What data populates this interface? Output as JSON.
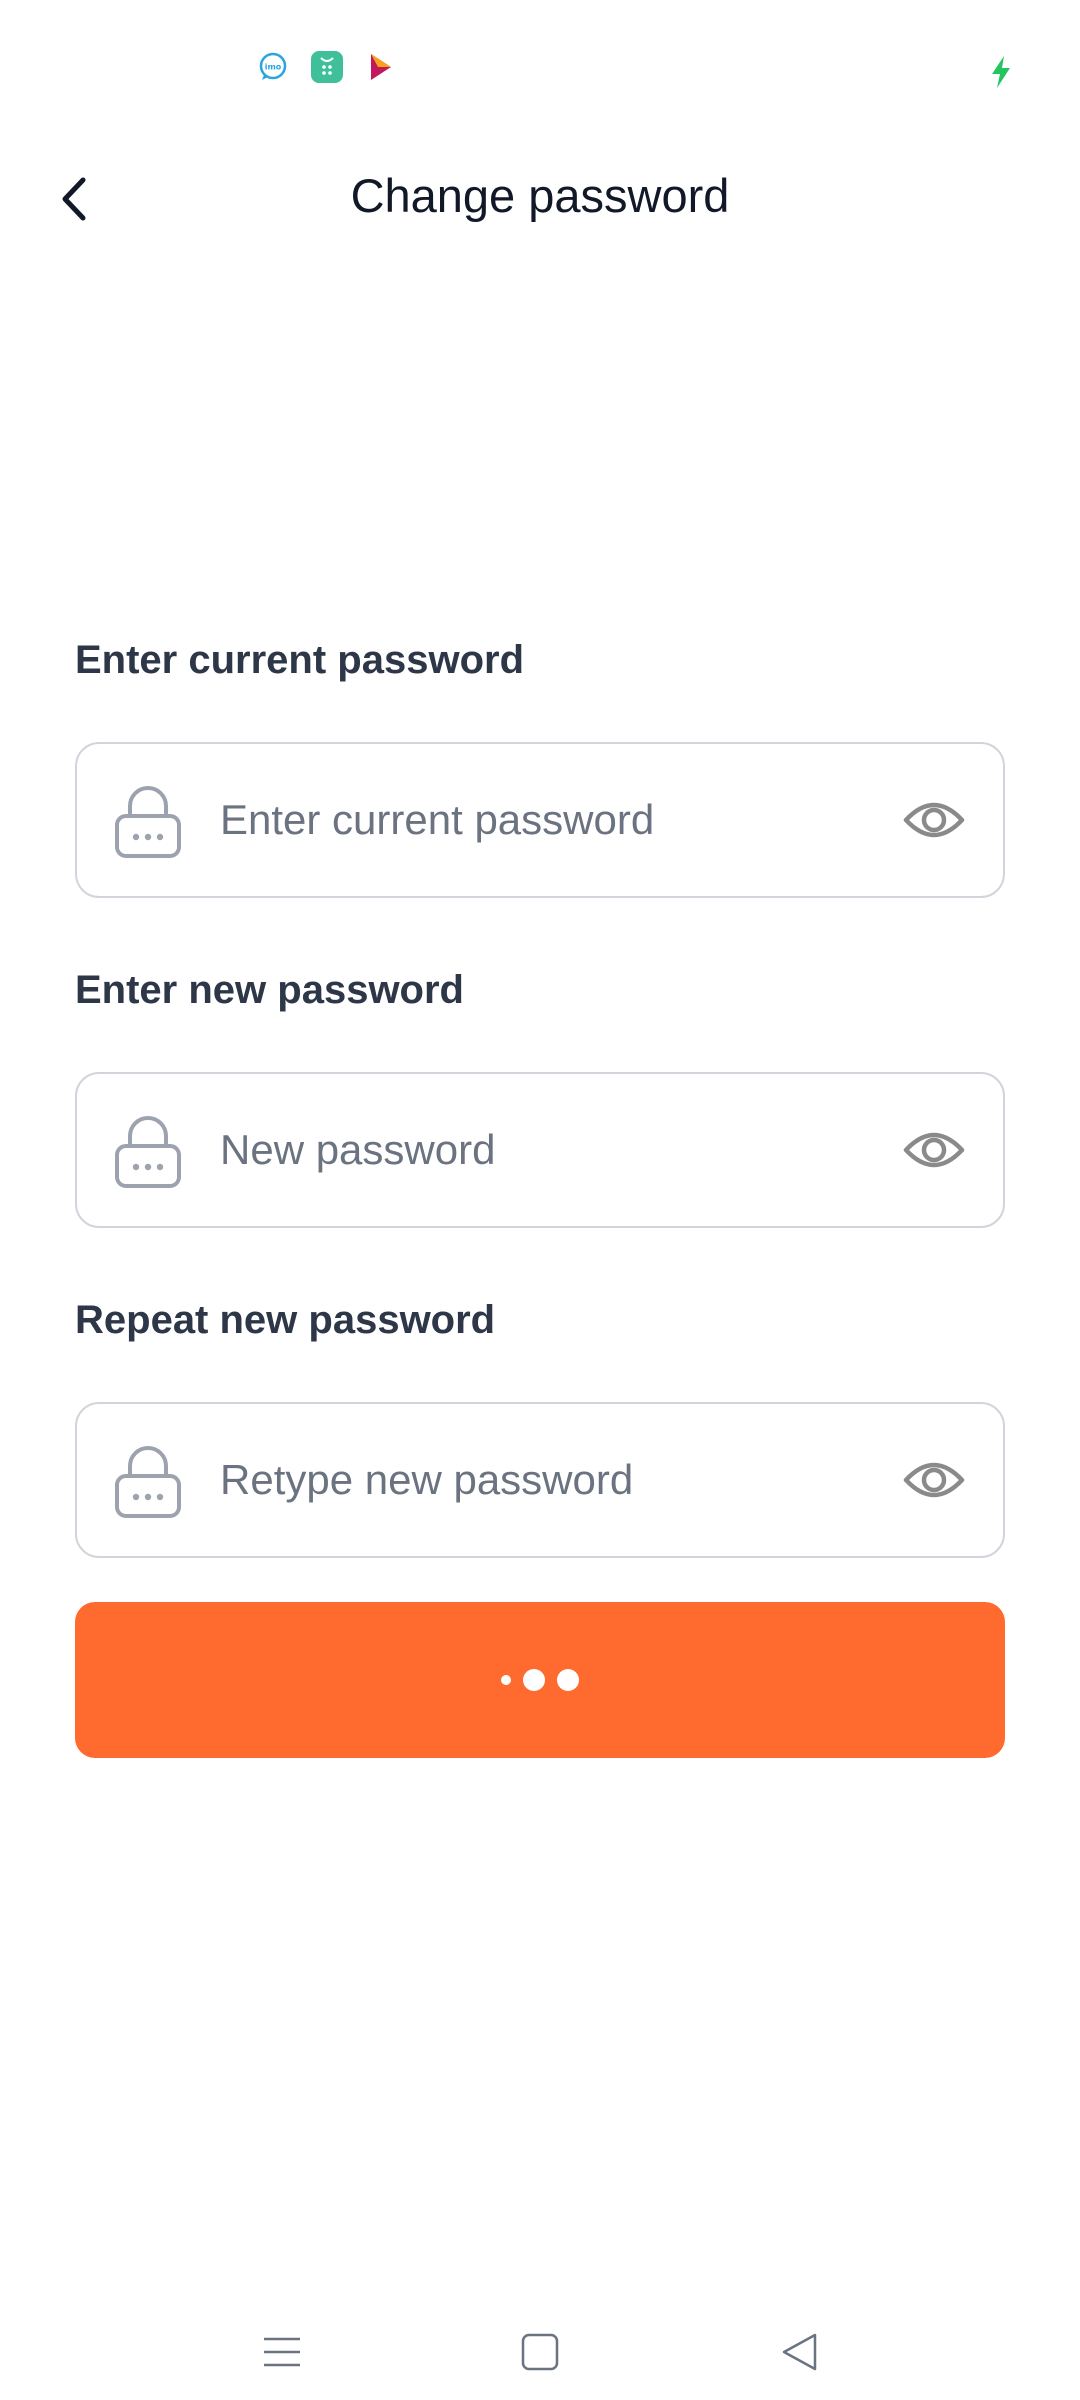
{
  "status_bar": {
    "notification_icons": [
      "imo-icon",
      "app-store-icon",
      "play-triangle-icon"
    ],
    "charging_icon": "charging-bolt-icon"
  },
  "header": {
    "title": "Change password",
    "back_icon": "chevron-left-icon"
  },
  "form": {
    "fields": [
      {
        "label": "Enter current password",
        "placeholder": "Enter current password",
        "value": ""
      },
      {
        "label": "Enter new password",
        "placeholder": "New password",
        "value": ""
      },
      {
        "label": "Repeat new password",
        "placeholder": "Retype new password",
        "value": ""
      }
    ]
  },
  "submit_button": {
    "state": "loading",
    "color": "#ff6b2e"
  },
  "nav_bar": {
    "items": [
      "menu-icon",
      "home-square-icon",
      "back-triangle-icon"
    ]
  },
  "colors": {
    "accent": "#ff6b2e",
    "label": "#2d3748",
    "placeholder": "#6b7280",
    "border": "#d1d5db"
  }
}
